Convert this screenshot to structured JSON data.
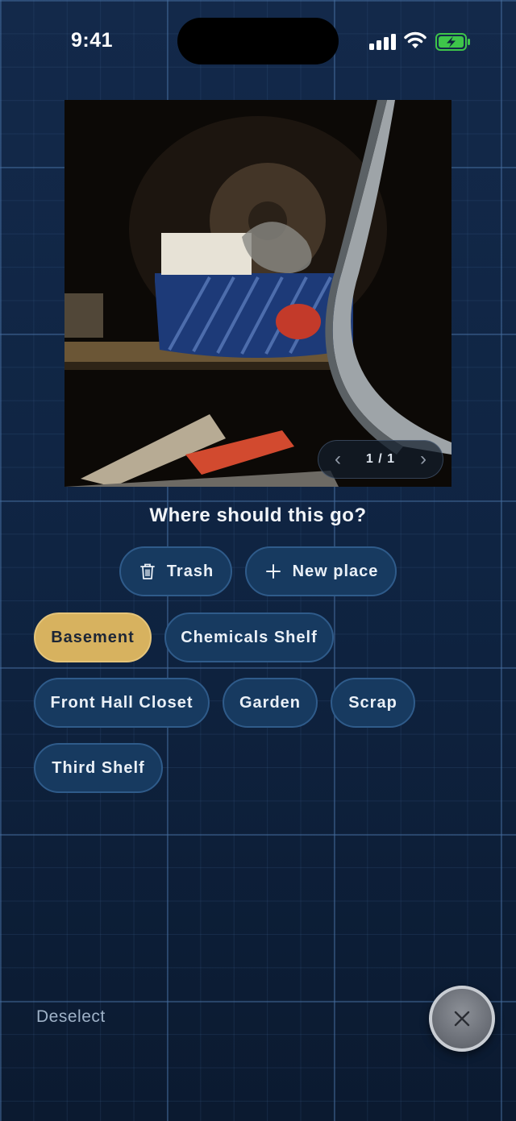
{
  "status_bar": {
    "time": "9:41"
  },
  "photo": {
    "pager": {
      "current_label": "1 / 1"
    }
  },
  "prompt": {
    "question": "Where should this go?"
  },
  "actions": {
    "trash_label": "Trash",
    "new_place_label": "New place"
  },
  "places": [
    {
      "label": "Basement",
      "selected": true
    },
    {
      "label": "Chemicals Shelf",
      "selected": false
    },
    {
      "label": "Front Hall Closet",
      "selected": false
    },
    {
      "label": "Garden",
      "selected": false
    },
    {
      "label": "Scrap",
      "selected": false
    },
    {
      "label": "Third Shelf",
      "selected": false
    }
  ],
  "footer": {
    "deselect_label": "Deselect"
  },
  "colors": {
    "background": "#0f2440",
    "chip": "#173a60",
    "chip_selected": "#d7b25f"
  },
  "icons": [
    "trash-icon",
    "plus-icon",
    "chevron-left-icon",
    "chevron-right-icon",
    "close-icon"
  ]
}
